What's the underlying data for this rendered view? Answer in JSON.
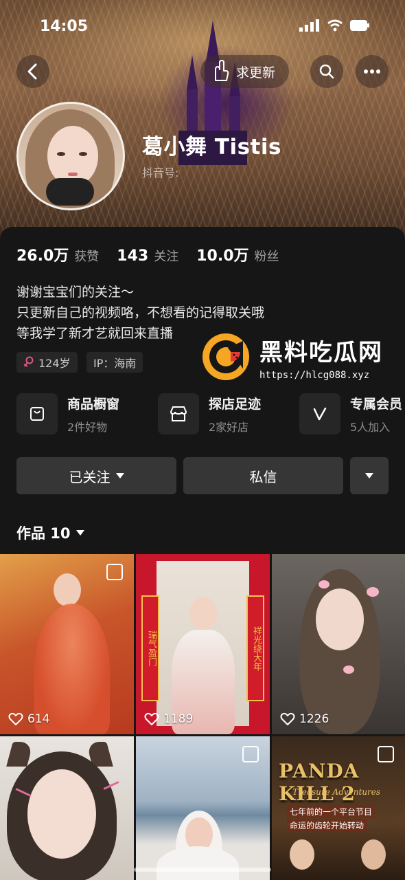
{
  "status_bar": {
    "time": "14:05"
  },
  "header": {
    "update_label": "求更新"
  },
  "profile": {
    "nickname": "葛小舞 Tistis",
    "douyin_id_label": "抖音号:",
    "stats": [
      {
        "value": "26.0万",
        "label": "获赞"
      },
      {
        "value": "143",
        "label": "关注"
      },
      {
        "value": "10.0万",
        "label": "粉丝"
      }
    ],
    "bio": [
      "谢谢宝宝们的关注～",
      "只更新自己的视频咯，不想看的记得取关哦",
      "等我学了新才艺就回来直播"
    ],
    "tags": {
      "age": "124岁",
      "ip": "IP：海南"
    }
  },
  "services": [
    {
      "title": "商品橱窗",
      "sub": "2件好物",
      "icon": "shopping-bag-icon"
    },
    {
      "title": "探店足迹",
      "sub": "2家好店",
      "icon": "store-icon"
    },
    {
      "title": "专属会员",
      "sub": "5人加入",
      "icon": "vip-icon"
    }
  ],
  "actions": {
    "follow": "已关注",
    "message": "私信"
  },
  "works": {
    "label": "作品 10"
  },
  "watermark": {
    "title": "黑料吃瓜网",
    "url": "https://hlcg088.xyz"
  },
  "videos": [
    {
      "likes": "614"
    },
    {
      "likes": "1189"
    },
    {
      "likes": "1226"
    },
    {
      "likes": ""
    },
    {
      "likes": ""
    },
    {
      "likes": ""
    }
  ],
  "thumbnail_text": {
    "couplet_left": "瑞气盈门",
    "couplet_right": "祥光绕大年",
    "game_title": "PANDA KILL 2",
    "game_subtitle": "Treasure Adventures",
    "game_caption": "七年前的一个平台节目",
    "game_caption2": "命运的齿轮开始转动"
  },
  "colors": {
    "background": "#161616",
    "card": "#262626",
    "button": "#363636",
    "accent_orange": "#f5a623"
  }
}
